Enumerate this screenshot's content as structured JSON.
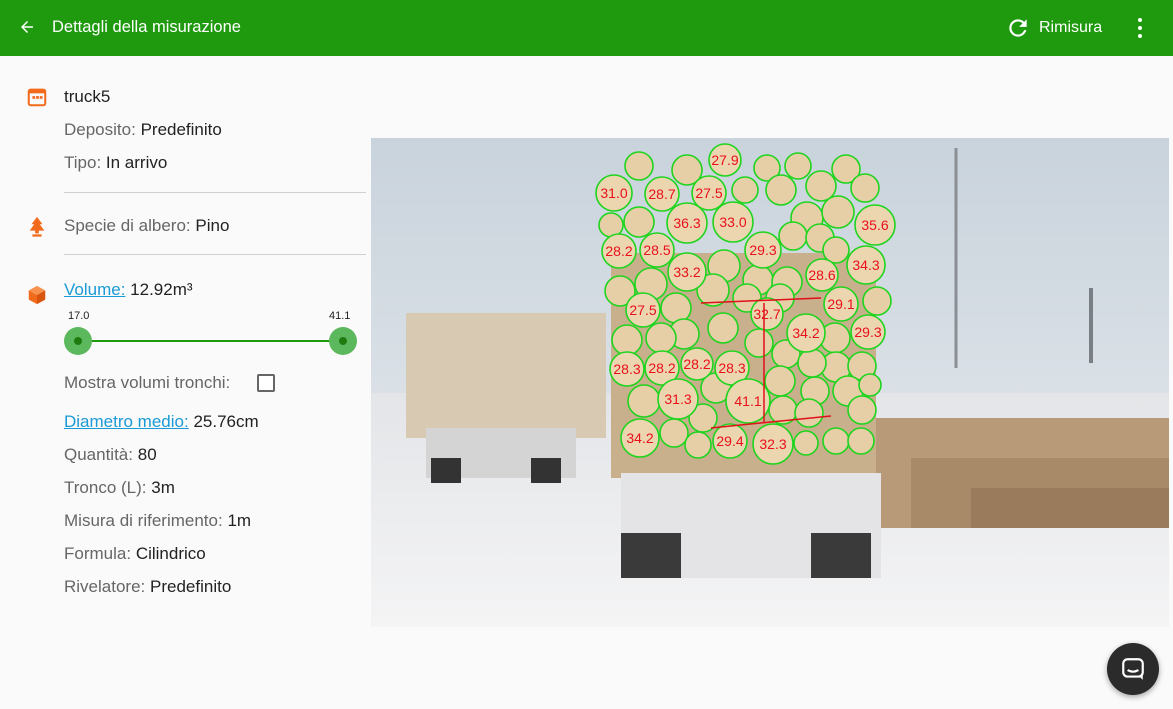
{
  "appbar": {
    "title": "Dettagli della misurazione",
    "remeasure_label": "Rimisura",
    "color": "#1f9a0f"
  },
  "details": {
    "name": "truck5",
    "deposit_label": "Deposito:",
    "deposit_value": "Predefinito",
    "type_label": "Tipo:",
    "type_value": "In arrivo",
    "species_label": "Specie di albero:",
    "species_value": "Pino",
    "volume_label": "Volume:",
    "volume_value": "12.92m³",
    "slider_min": "17.0",
    "slider_max": "41.1",
    "show_volumes_label": "Mostra volumi tronchi:",
    "avg_diameter_label": "Diametro medio:",
    "avg_diameter_value": "25.76cm",
    "quantity_label": "Quantità:",
    "quantity_value": "80",
    "log_length_label": "Tronco (L):",
    "log_length_value": "3m",
    "reference_label": "Misura di riferimento:",
    "reference_value": "1m",
    "formula_label": "Formula:",
    "formula_value": "Cilindrico",
    "detector_label": "Rivelatore:",
    "detector_value": "Predefinito"
  },
  "icons": {
    "back": "arrow-back-icon",
    "refresh": "refresh-icon",
    "more": "more-vert-icon",
    "calendar": "calendar-icon",
    "tree": "tree-icon",
    "cube": "cube-icon",
    "chat": "chat-icon",
    "accent_orange": "#f26a1b"
  },
  "photo": {
    "labels": [
      "27.9",
      "31.0",
      "28.7",
      "27.5",
      "36.3",
      "33.0",
      "35.6",
      "28.2",
      "28.5",
      "29.3",
      "33.2",
      "34.3",
      "28.6",
      "27.5",
      "29.1",
      "32.7",
      "34.2",
      "29.3",
      "28.3",
      "28.2",
      "28.2",
      "28.3",
      "31.3",
      "41.1",
      "34.2",
      "29.4",
      "32.3"
    ]
  }
}
